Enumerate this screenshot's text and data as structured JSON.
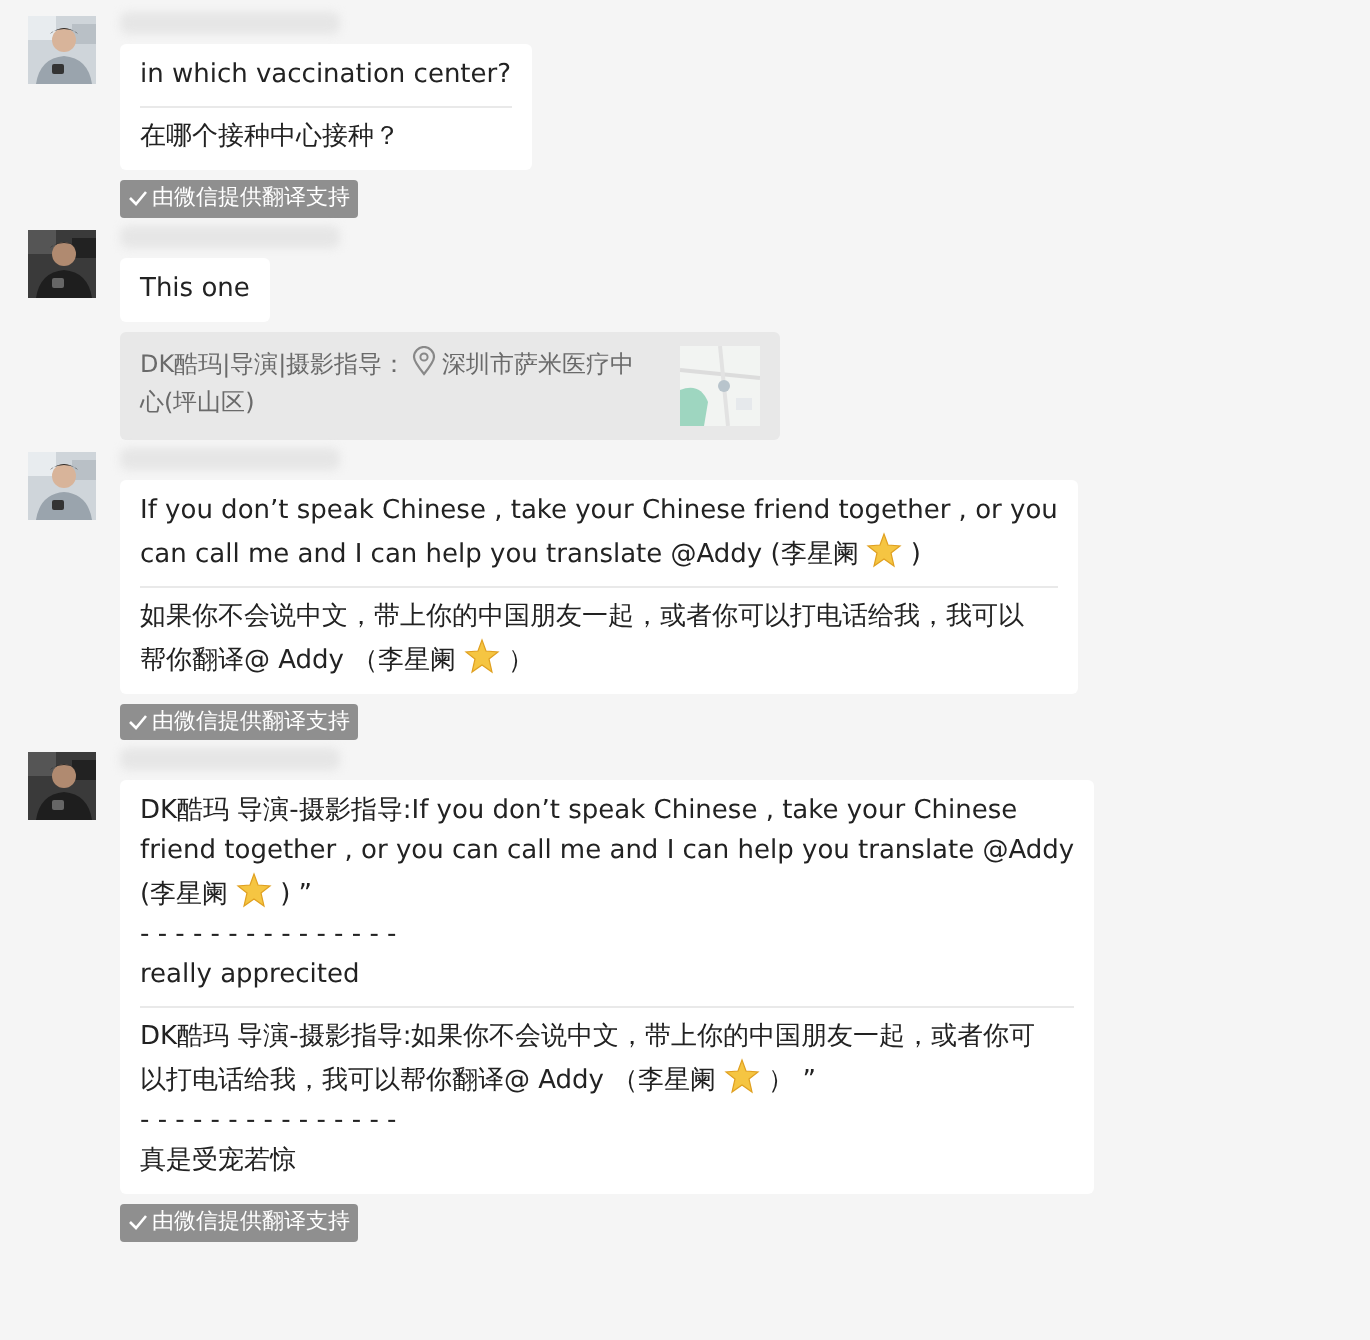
{
  "messages": [
    {
      "items": [
        {
          "kind": "bubble",
          "blocks": [
            {
              "kind": "line",
              "segments": [
                {
                  "kind": "text",
                  "text": "in which vaccination center?"
                }
              ]
            },
            {
              "kind": "divider"
            },
            {
              "kind": "line",
              "segments": [
                {
                  "kind": "text",
                  "text": "在哪个接种中心接种？"
                }
              ]
            }
          ]
        }
      ],
      "badge": "由微信提供翻译支持"
    },
    {
      "items": [
        {
          "kind": "bubble",
          "blocks": [
            {
              "kind": "line",
              "segments": [
                {
                  "kind": "text",
                  "text": "This one"
                }
              ]
            }
          ]
        },
        {
          "kind": "location",
          "sender": "DK酷玛|导演|摄影指导：",
          "address_lines": [
            "深圳市萨米医疗中",
            "心(坪山区)"
          ]
        }
      ]
    },
    {
      "items": [
        {
          "kind": "bubble",
          "blocks": [
            {
              "kind": "line",
              "segments": [
                {
                  "kind": "text",
                  "text": "If you don’t speak Chinese , take your Chinese friend together , or you"
                }
              ]
            },
            {
              "kind": "line",
              "segments": [
                {
                  "kind": "text",
                  "text": "can call me and I can help you translate @Addy (李星阑"
                },
                {
                  "kind": "emoji"
                },
                {
                  "kind": "text",
                  "text": ")"
                }
              ]
            },
            {
              "kind": "divider"
            },
            {
              "kind": "line",
              "segments": [
                {
                  "kind": "text",
                  "text": "如果你不会说中文，带上你的中国朋友一起，或者你可以打电话给我，我可以"
                }
              ]
            },
            {
              "kind": "line",
              "segments": [
                {
                  "kind": "text",
                  "text": "帮你翻译@ Addy （李星阑"
                },
                {
                  "kind": "emoji"
                },
                {
                  "kind": "text",
                  "text": "）"
                }
              ]
            }
          ]
        }
      ],
      "badge": "由微信提供翻译支持"
    },
    {
      "items": [
        {
          "kind": "bubble",
          "blocks": [
            {
              "kind": "line",
              "segments": [
                {
                  "kind": "text",
                  "text": "DK酷玛 导演-摄影指导:If you don’t speak Chinese , take your Chinese"
                }
              ]
            },
            {
              "kind": "line",
              "segments": [
                {
                  "kind": "text",
                  "text": "friend together , or you can call me and I can help you translate @Addy"
                }
              ]
            },
            {
              "kind": "line",
              "segments": [
                {
                  "kind": "text",
                  "text": "(李星阑"
                },
                {
                  "kind": "emoji"
                },
                {
                  "kind": "text",
                  "text": ") ”"
                }
              ]
            },
            {
              "kind": "line",
              "segments": [
                {
                  "kind": "text",
                  "text": "- - - - - - - - - - - - - - -"
                }
              ]
            },
            {
              "kind": "line",
              "segments": [
                {
                  "kind": "text",
                  "text": "really apprecited"
                }
              ]
            },
            {
              "kind": "divider"
            },
            {
              "kind": "line",
              "segments": [
                {
                  "kind": "text",
                  "text": "DK酷玛 导演-摄影指导:如果你不会说中文，带上你的中国朋友一起，或者你可"
                }
              ]
            },
            {
              "kind": "line",
              "segments": [
                {
                  "kind": "text",
                  "text": "以打电话给我，我可以帮你翻译@ Addy （李星阑"
                },
                {
                  "kind": "emoji"
                },
                {
                  "kind": "text",
                  "text": "） ”"
                }
              ]
            },
            {
              "kind": "line",
              "segments": [
                {
                  "kind": "text",
                  "text": "- - - - - - - - - - - - - - -"
                }
              ]
            },
            {
              "kind": "line",
              "segments": [
                {
                  "kind": "text",
                  "text": "真是受宠若惊"
                }
              ]
            }
          ]
        }
      ],
      "badge": "由微信提供翻译支持"
    }
  ]
}
